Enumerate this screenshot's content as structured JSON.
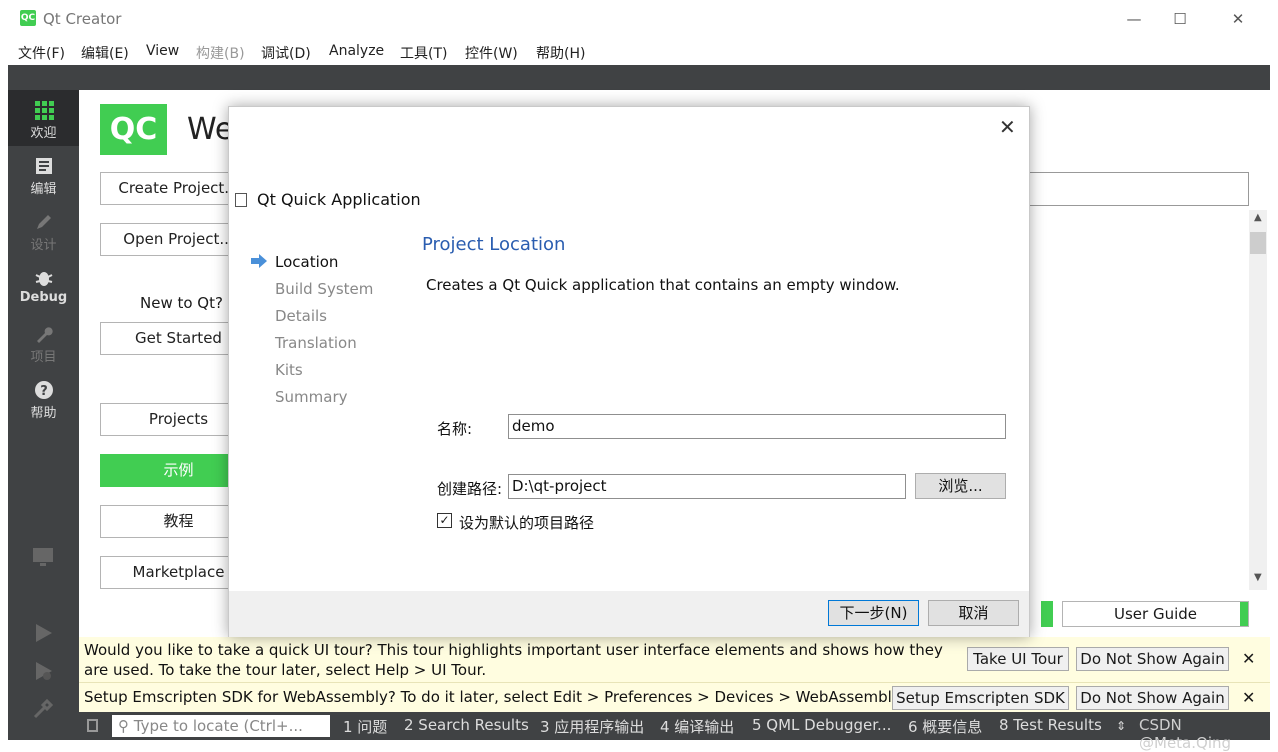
{
  "app": {
    "title": "Qt Creator",
    "icon_text": "QC"
  },
  "window_controls": {
    "minimize": "—",
    "maximize": "☐",
    "close": "✕"
  },
  "menu": [
    "文件(F)",
    "编辑(E)",
    "View",
    "构建(B)",
    "调试(D)",
    "Analyze",
    "工具(T)",
    "控件(W)",
    "帮助(H)"
  ],
  "menu_disabled_index": 3,
  "modes": [
    {
      "label": "欢迎",
      "icon": "grid-icon"
    },
    {
      "label": "编辑",
      "icon": "edit-icon"
    },
    {
      "label": "设计",
      "icon": "pen-icon"
    },
    {
      "label": "Debug",
      "icon": "bug-icon"
    },
    {
      "label": "项目",
      "icon": "wrench-icon"
    },
    {
      "label": "帮助",
      "icon": "help-icon"
    }
  ],
  "welcome": {
    "logo": "QC",
    "title": "We",
    "create": "Create Project...",
    "open": "Open Project...",
    "new_to_qt": "New to Qt?",
    "get_started": "Get Started",
    "projects": "Projects",
    "examples": "示例",
    "tutorials": "教程",
    "marketplace": "Marketplace",
    "user_guide": "User Guide"
  },
  "dialog": {
    "title": "Qt Quick Application",
    "close": "✕",
    "steps": [
      "Location",
      "Build System",
      "Details",
      "Translation",
      "Kits",
      "Summary"
    ],
    "current_step": "Location",
    "heading": "Project Location",
    "description": "Creates a Qt Quick application that contains an empty window.",
    "name_label": "名称:",
    "name_value": "demo",
    "path_label": "创建路径:",
    "path_value": "D:\\qt-project",
    "browse": "浏览...",
    "default_checkbox": "设为默认的项目路径",
    "default_checked": true,
    "next": "下一步(N)",
    "cancel": "取消"
  },
  "notifications": [
    {
      "text": "Would you like to take a quick UI tour? This tour highlights important user interface elements and shows how they are used. To take the tour later, select Help > UI Tour.",
      "btn1": "Take UI Tour",
      "btn2": "Do Not Show Again"
    },
    {
      "text": "Setup Emscripten SDK for WebAssembly? To do it later, select Edit > Preferences > Devices > WebAssembly.",
      "btn1": "Setup Emscripten SDK",
      "btn2": "Do Not Show Again"
    }
  ],
  "statusbar": {
    "locate_placeholder": "Type to locate (Ctrl+...",
    "tabs": [
      "1 问题",
      "2 Search Results",
      "3 应用程序输出",
      "4 编译输出",
      "5 QML Debugger...",
      "6 概要信息",
      "8 Test Results"
    ],
    "watermark": "CSDN @Meta.Qing"
  }
}
